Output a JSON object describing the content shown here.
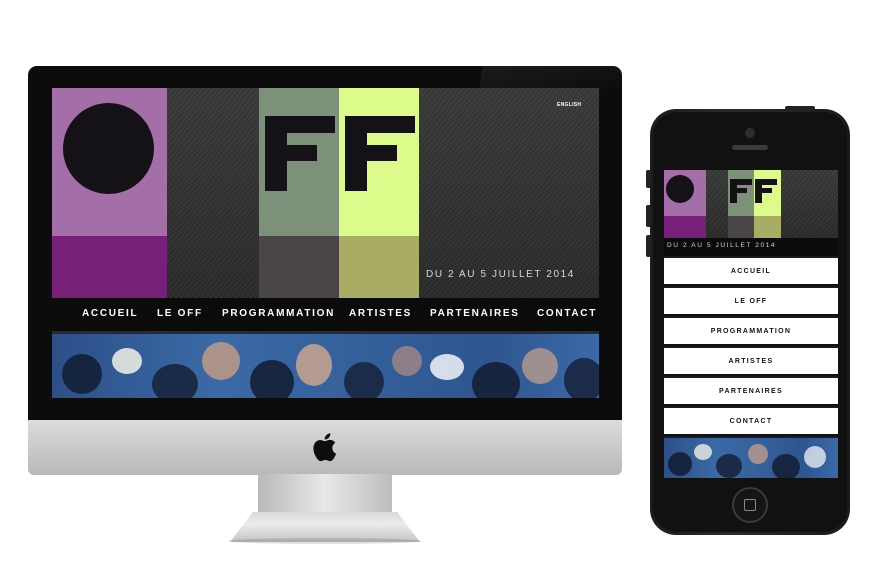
{
  "site": {
    "language_link": "ENGLISH",
    "date": "DU 2 AU 5 JUILLET 2014",
    "phone_date": "DU 2 AU 5 JUILLET 2014",
    "logo_letters": [
      "F",
      "F"
    ]
  },
  "nav": {
    "items": [
      "ACCUEIL",
      "LE OFF",
      "PROGRAMMATION",
      "ARTISTES",
      "PARTENAIRES",
      "CONTACT"
    ]
  },
  "colors": {
    "violet_light": "#a46ea9",
    "violet_dark": "#781f79",
    "sage": "#7d917a",
    "lime": "#dcfb8a",
    "charcoal": "#4a4547",
    "olive": "#a9ac63",
    "ink": "#141217"
  },
  "icons": [
    "apple-icon"
  ]
}
